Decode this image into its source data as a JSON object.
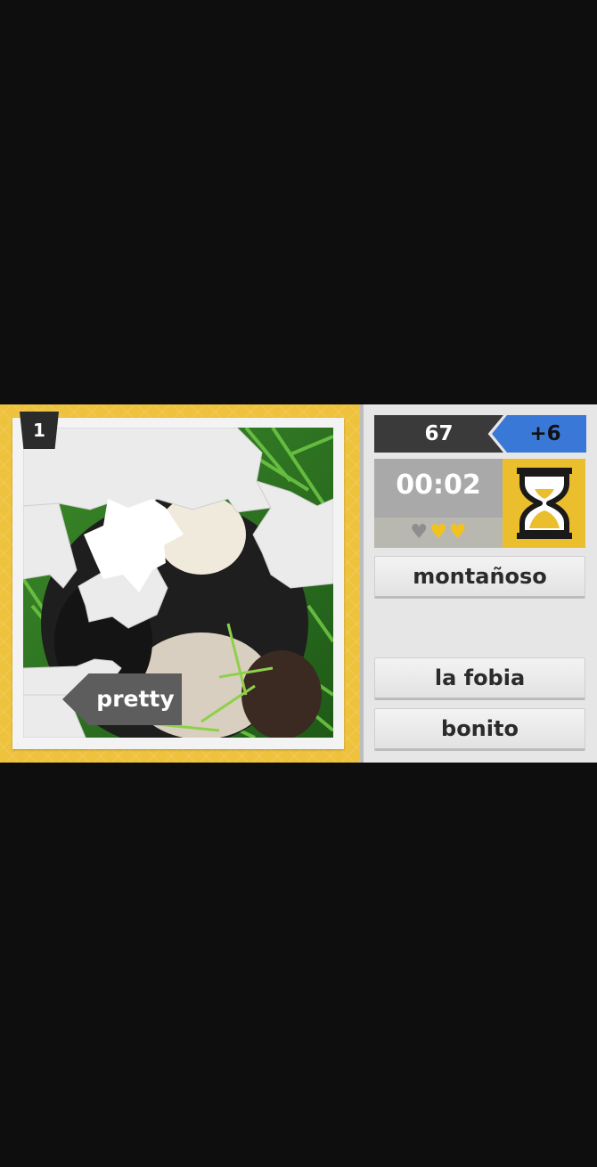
{
  "level": "1",
  "prompt_word": "pretty",
  "score": "67",
  "bonus": "+6",
  "timer": "00:02",
  "lives": {
    "lost": 1,
    "remaining": 2
  },
  "answers": [
    "montañoso",
    "",
    "la fobia",
    "bonito"
  ],
  "colors": {
    "board": "#eec23c",
    "bonus": "#3a78d8",
    "hourglass": "#ebbe2e",
    "heart": "#f2c21f"
  }
}
